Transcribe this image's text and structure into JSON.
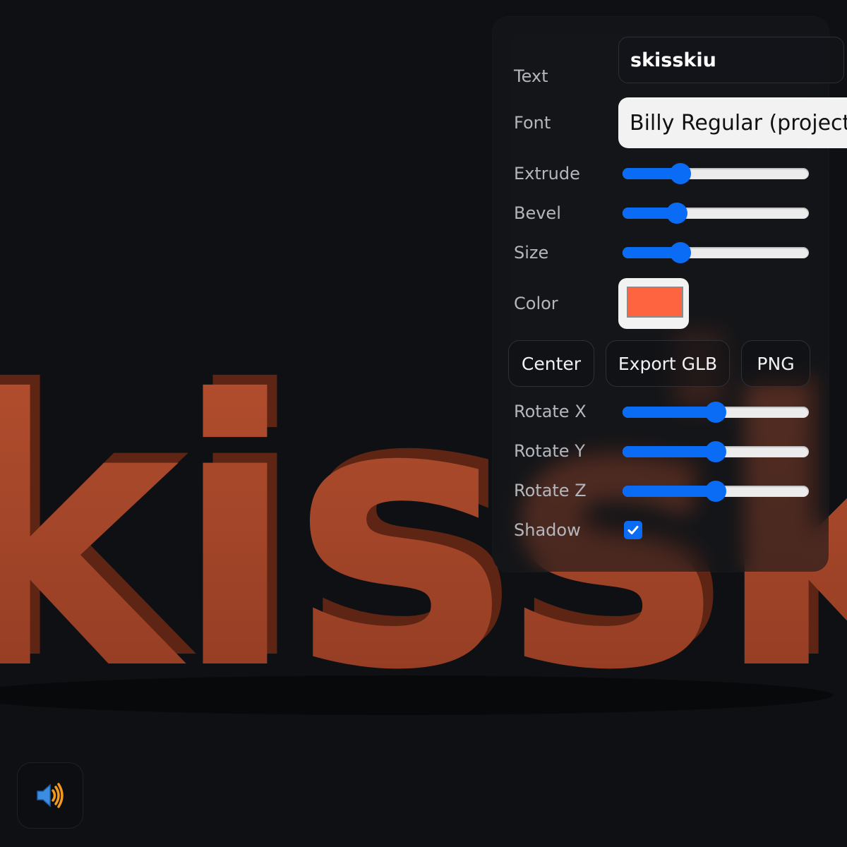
{
  "scene": {
    "rendered_text": "kissk",
    "material_color": "#a8452a"
  },
  "panel": {
    "text_label": "Text",
    "text_value": "skisskiu",
    "font_label": "Font",
    "font_value": "Billy Regular (project)",
    "extrude_label": "Extrude",
    "extrude_value": 0.31,
    "bevel_label": "Bevel",
    "bevel_value": 0.29,
    "size_label": "Size",
    "size_value": 0.31,
    "color_label": "Color",
    "color_value": "#ff6440",
    "center_button": "Center",
    "export_glb_button": "Export GLB",
    "png_button": "PNG",
    "rotate_x_label": "Rotate X",
    "rotate_x_value": 0.5,
    "rotate_y_label": "Rotate Y",
    "rotate_y_value": 0.5,
    "rotate_z_label": "Rotate Z",
    "rotate_z_value": 0.5,
    "shadow_label": "Shadow",
    "shadow_checked": true,
    "accent_color": "#0a6cf5"
  },
  "audio": {
    "icon": "speaker-icon"
  }
}
